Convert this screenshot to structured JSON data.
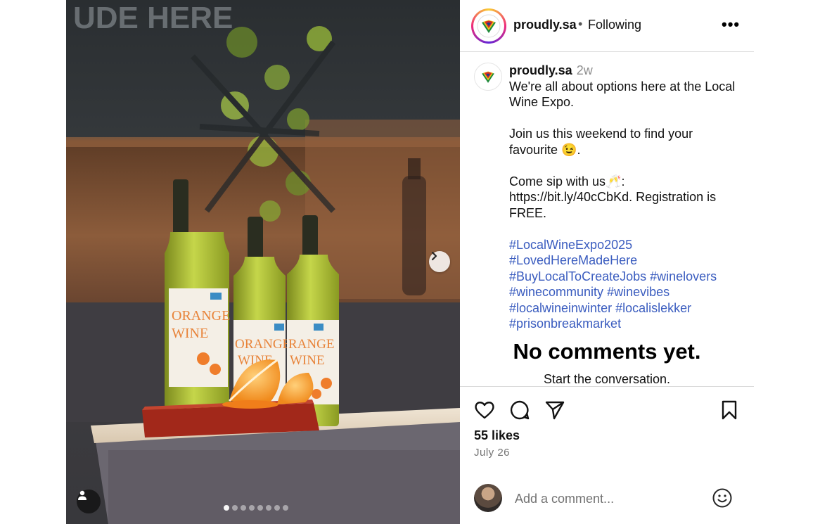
{
  "post": {
    "username": "proudly.sa",
    "follow_dot": "•",
    "follow_status": "Following",
    "more_label": "•••",
    "caption_user": "proudly.sa",
    "caption_time": "2w",
    "caption_line1": "We're all about options here at the Local Wine Expo.",
    "caption_line2": "Join us this weekend to find your favourite 😉.",
    "caption_line3a": "Come sip with us🥂:",
    "caption_line3b": "https://bit.ly/40cCbKd. Registration is FREE.",
    "hashtags": [
      "#LocalWineExpo2025",
      "#LovedHereMadeHere",
      "#BuyLocalToCreateJobs",
      "#winelovers",
      "#winecommunity",
      "#winevibes",
      "#localwineinwinter",
      "#localislekker",
      "#prisonbreakmarket"
    ],
    "no_comments": "No comments yet.",
    "start_conversation": "Start the conversation.",
    "likes": "55 likes",
    "date": "July 26",
    "comment_placeholder": "Add a comment..."
  },
  "icons": {
    "like": "heart-icon",
    "comment": "comment-bubble-icon",
    "share": "paper-plane-icon",
    "save": "bookmark-icon",
    "next": "chevron-right-icon",
    "tag": "user-tag-icon",
    "emoji": "smiley-icon"
  },
  "carousel": {
    "slide_count": 8,
    "current_slide": 1
  },
  "colors": {
    "hashtag": "#3a5cbf",
    "secondary_text": "#737373",
    "divider": "#dbdbdb"
  }
}
